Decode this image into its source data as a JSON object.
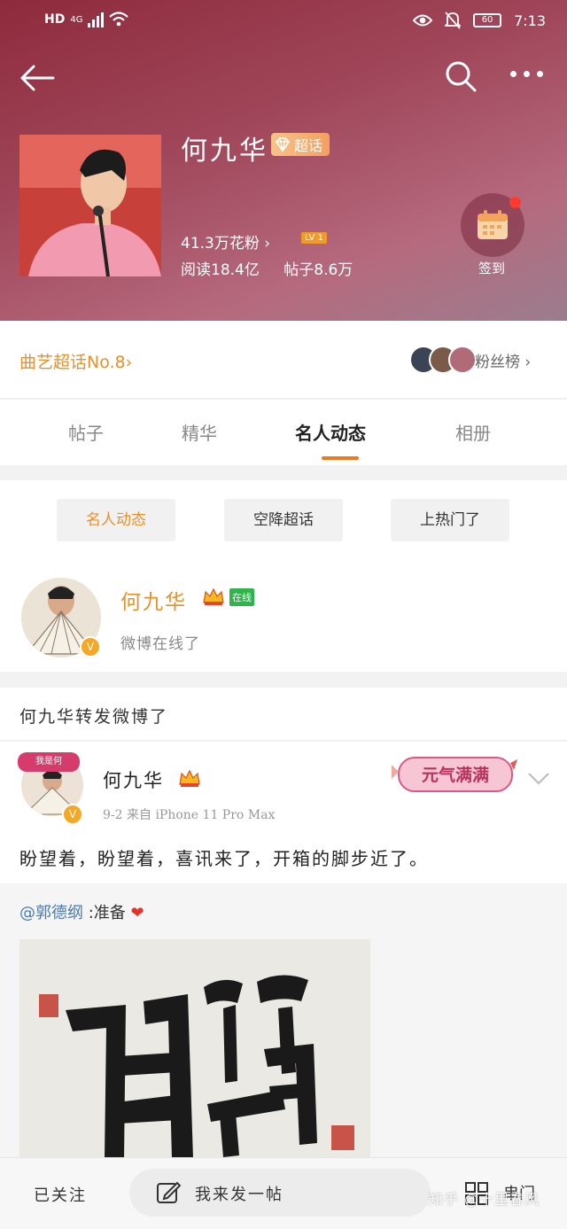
{
  "status_bar": {
    "network": "HD",
    "network_gen": "4G",
    "battery": "60",
    "time": "7:13"
  },
  "topic": {
    "title": "何九华",
    "badge": "超话",
    "fans": "41.3万花粉 ›",
    "level": "LV 1",
    "reads": "阅读18.4亿",
    "posts": "帖子8.6万",
    "checkin_label": "签到"
  },
  "rank": {
    "left": "曲艺超话No.8›",
    "right": "粉丝榜 ›"
  },
  "tabs": [
    "帖子",
    "精华",
    "名人动态",
    "相册"
  ],
  "filters": [
    "名人动态",
    "空降超话",
    "上热门了"
  ],
  "online": {
    "name": "何九华",
    "tag": "在线",
    "status": "微博在线了"
  },
  "repost_header": "何九华转发微博了",
  "post": {
    "author": "何九华",
    "avatar_sticker": "我是何",
    "meta": "9-2  来自 iPhone 11 Pro Max",
    "sticker": "元气满满",
    "text": "盼望着，盼望着，喜讯来了，开箱的脚步近了。"
  },
  "quote": {
    "mention": "@郭德纲",
    "text": " :准备"
  },
  "bottom": {
    "followed": "已关注",
    "compose": "我来发一帖",
    "mirror": "串门"
  },
  "watermark": "知乎 @十里春风",
  "colors": {
    "accent": "#e8902a",
    "header": "#a0465a",
    "online": "#2db44a"
  }
}
